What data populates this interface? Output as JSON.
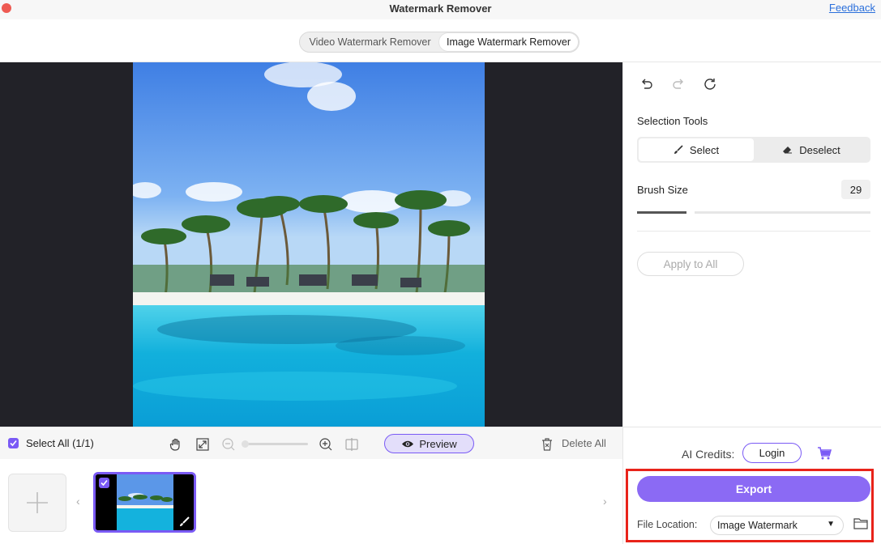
{
  "app": {
    "title": "Watermark Remover",
    "feedback_label": "Feedback"
  },
  "mode_tabs": [
    {
      "label": "Video Watermark Remover",
      "active": false
    },
    {
      "label": "Image Watermark Remover",
      "active": true
    }
  ],
  "toolbar": {
    "select_all_label": "Select All (1/1)",
    "preview_label": "Preview",
    "delete_all_label": "Delete All"
  },
  "panel": {
    "selection_tools_label": "Selection Tools",
    "select_label": "Select",
    "deselect_label": "Deselect",
    "brush_size_label": "Brush Size",
    "brush_size_value": "29",
    "apply_to_all_label": "Apply to All"
  },
  "bottom": {
    "ai_credits_label": "AI Credits:",
    "login_label": "Login",
    "export_label": "Export",
    "file_location_label": "File Location:",
    "file_location_value": "Image Watermark"
  },
  "colors": {
    "accent": "#7a5af5",
    "export_button": "#8b6af4",
    "highlight_border": "#e8231a",
    "canvas_background": "#222228"
  },
  "icons": [
    "undo-icon",
    "redo-icon",
    "reset-icon",
    "brush-icon",
    "eraser-icon",
    "hand-icon",
    "fit-icon",
    "zoom-out-icon",
    "zoom-in-icon",
    "compare-icon",
    "eye-icon",
    "trash-icon",
    "plus-icon",
    "cart-icon",
    "folder-icon",
    "chevron-down-icon"
  ]
}
